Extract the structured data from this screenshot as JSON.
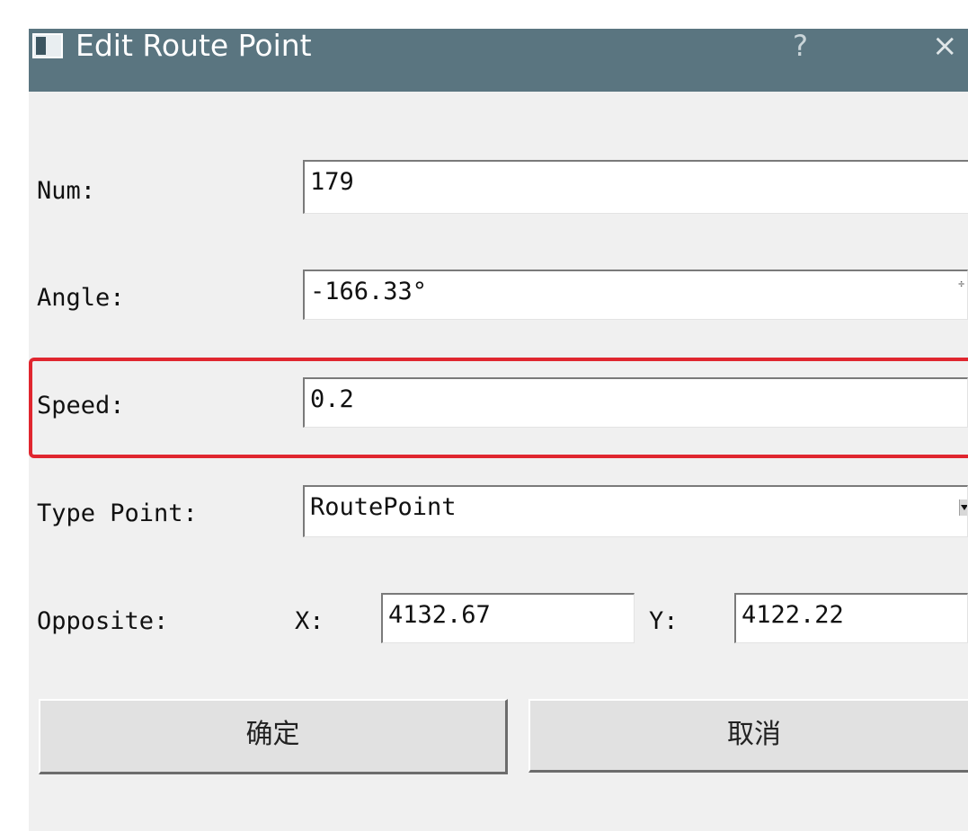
{
  "dialog": {
    "title": "Edit Route Point",
    "help_glyph": "?",
    "close_glyph": "×",
    "icon": "window-app-icon"
  },
  "form": {
    "num": {
      "label": "Num:",
      "value": "179"
    },
    "angle": {
      "label": "Angle:",
      "value": "-166.33°",
      "spin_glyph": "÷"
    },
    "speed": {
      "label": "Speed:",
      "value": "0.2"
    },
    "type_point": {
      "label": "Type Point:",
      "value": "RoutePoint"
    },
    "opposite": {
      "label": "Opposite:",
      "x_label": "X:",
      "x_value": "4132.67",
      "y_label": "Y:",
      "y_value": "4122.22"
    }
  },
  "buttons": {
    "ok_label": "确定",
    "cancel_label": "取消"
  },
  "colors": {
    "titlebar": "#5a7580",
    "highlight": "#e0262f",
    "dialog_bg": "#f0f0f0"
  }
}
